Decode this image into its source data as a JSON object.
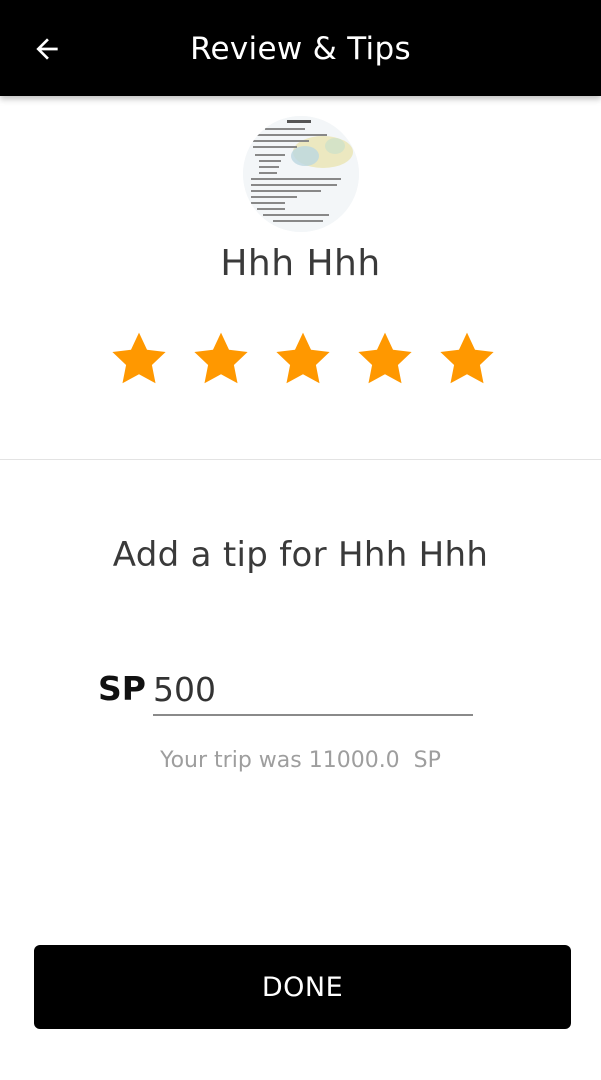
{
  "header": {
    "title": "Review & Tips",
    "back_icon": "arrow-left-icon"
  },
  "driver": {
    "name": "Hhh Hhh",
    "avatar_icon": "driver-avatar-image"
  },
  "rating": {
    "stars_filled": 5,
    "stars_total": 5,
    "star_icon": "star-icon",
    "star_color": "#FF9800"
  },
  "tip": {
    "heading": "Add a tip for Hhh Hhh",
    "currency": "SP",
    "amount": "500",
    "trip_info": "Your trip was 11000.0  SP"
  },
  "footer": {
    "done_label": "DONE"
  },
  "colors": {
    "header_bg": "#000000",
    "button_bg": "#000000",
    "accent_star": "#FF9800"
  }
}
